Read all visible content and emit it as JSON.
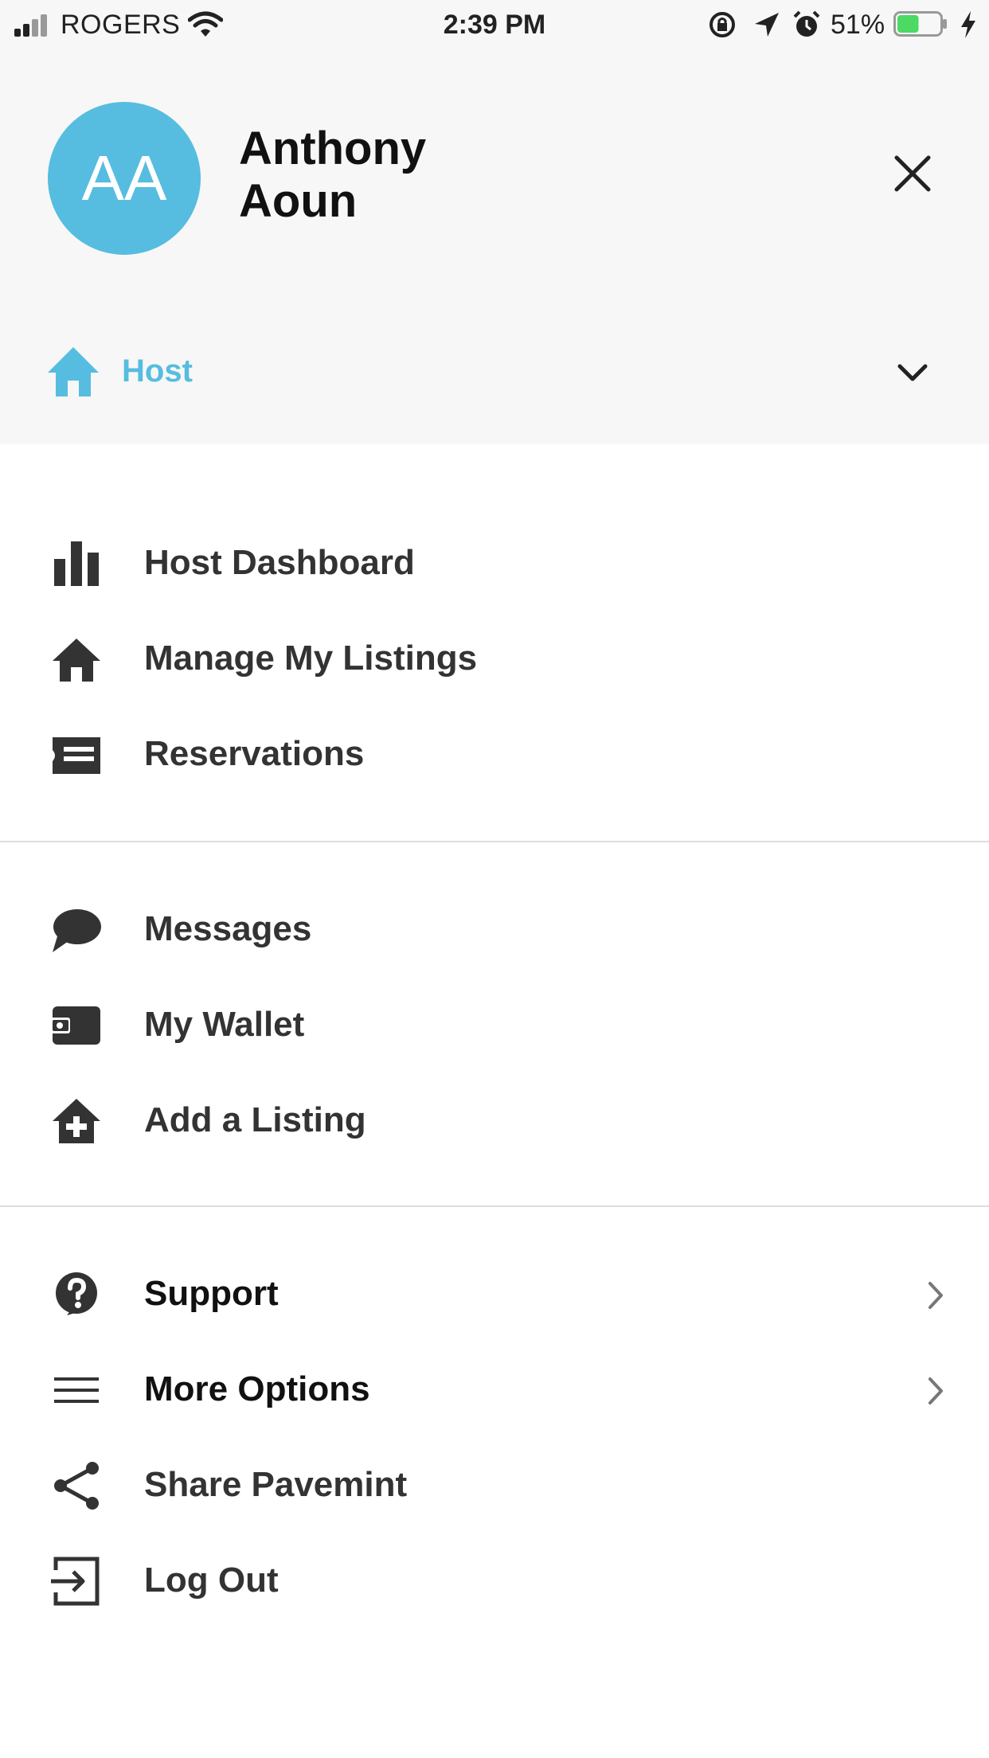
{
  "status_bar": {
    "carrier": "ROGERS",
    "time": "2:39 PM",
    "battery_percent": "51%",
    "battery_level": 0.51,
    "battery_color": "#4cd964"
  },
  "profile": {
    "initials": "AA",
    "name": "Anthony\nAoun",
    "avatar_color": "#56bde0"
  },
  "role": {
    "label": "Host",
    "color": "#56bde0"
  },
  "menu": {
    "section1": [
      {
        "label": "Host Dashboard",
        "icon": "bar-chart-icon"
      },
      {
        "label": "Manage My Listings",
        "icon": "home-icon"
      },
      {
        "label": "Reservations",
        "icon": "ticket-icon"
      }
    ],
    "section2": [
      {
        "label": "Messages",
        "icon": "speech-bubble-icon"
      },
      {
        "label": "My Wallet",
        "icon": "wallet-icon"
      },
      {
        "label": "Add a Listing",
        "icon": "add-home-icon"
      }
    ],
    "section3": [
      {
        "label": "Support",
        "icon": "help-circle-icon"
      },
      {
        "label": "More Options",
        "icon": "hamburger-icon"
      },
      {
        "label": "Share Pavemint",
        "icon": "share-icon"
      },
      {
        "label": "Log Out",
        "icon": "logout-icon"
      }
    ]
  }
}
